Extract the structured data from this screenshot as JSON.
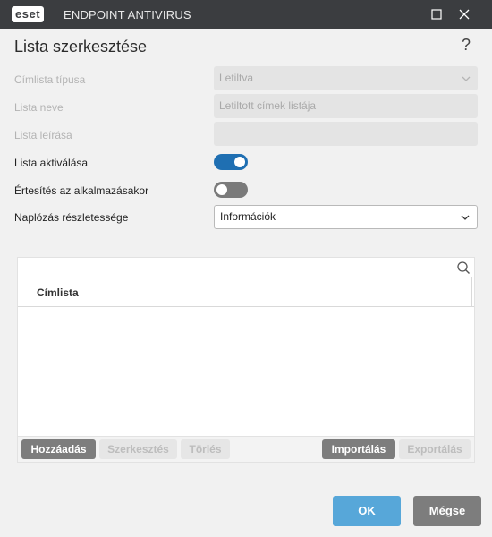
{
  "window": {
    "brand": "eset",
    "product": "ENDPOINT ANTIVIRUS"
  },
  "dialog": {
    "title": "Lista szerkesztése"
  },
  "form": {
    "list_type": {
      "label": "Címlista típusa",
      "value": "Letiltva"
    },
    "list_name": {
      "label": "Lista neve",
      "value": "Letiltott címek listája"
    },
    "list_description": {
      "label": "Lista leírása",
      "value": ""
    },
    "list_activation": {
      "label": "Lista aktiválása",
      "enabled": true
    },
    "notify_on_apply": {
      "label": "Értesítés az alkalmazásakor",
      "enabled": false
    },
    "log_verbosity": {
      "label": "Naplózás részletessége",
      "value": "Információk"
    }
  },
  "table": {
    "search_placeholder": "",
    "column": "Címlista",
    "rows": []
  },
  "table_buttons": {
    "add": "Hozzáadás",
    "edit": "Szerkesztés",
    "delete": "Törlés",
    "import": "Importálás",
    "export": "Exportálás"
  },
  "footer": {
    "ok": "OK",
    "cancel": "Mégse"
  },
  "colors": {
    "titlebar": "#3b3d40",
    "toggle_on": "#1f6fb2",
    "ok_button": "#57a7d9",
    "button_gray": "#7d7d7d"
  }
}
